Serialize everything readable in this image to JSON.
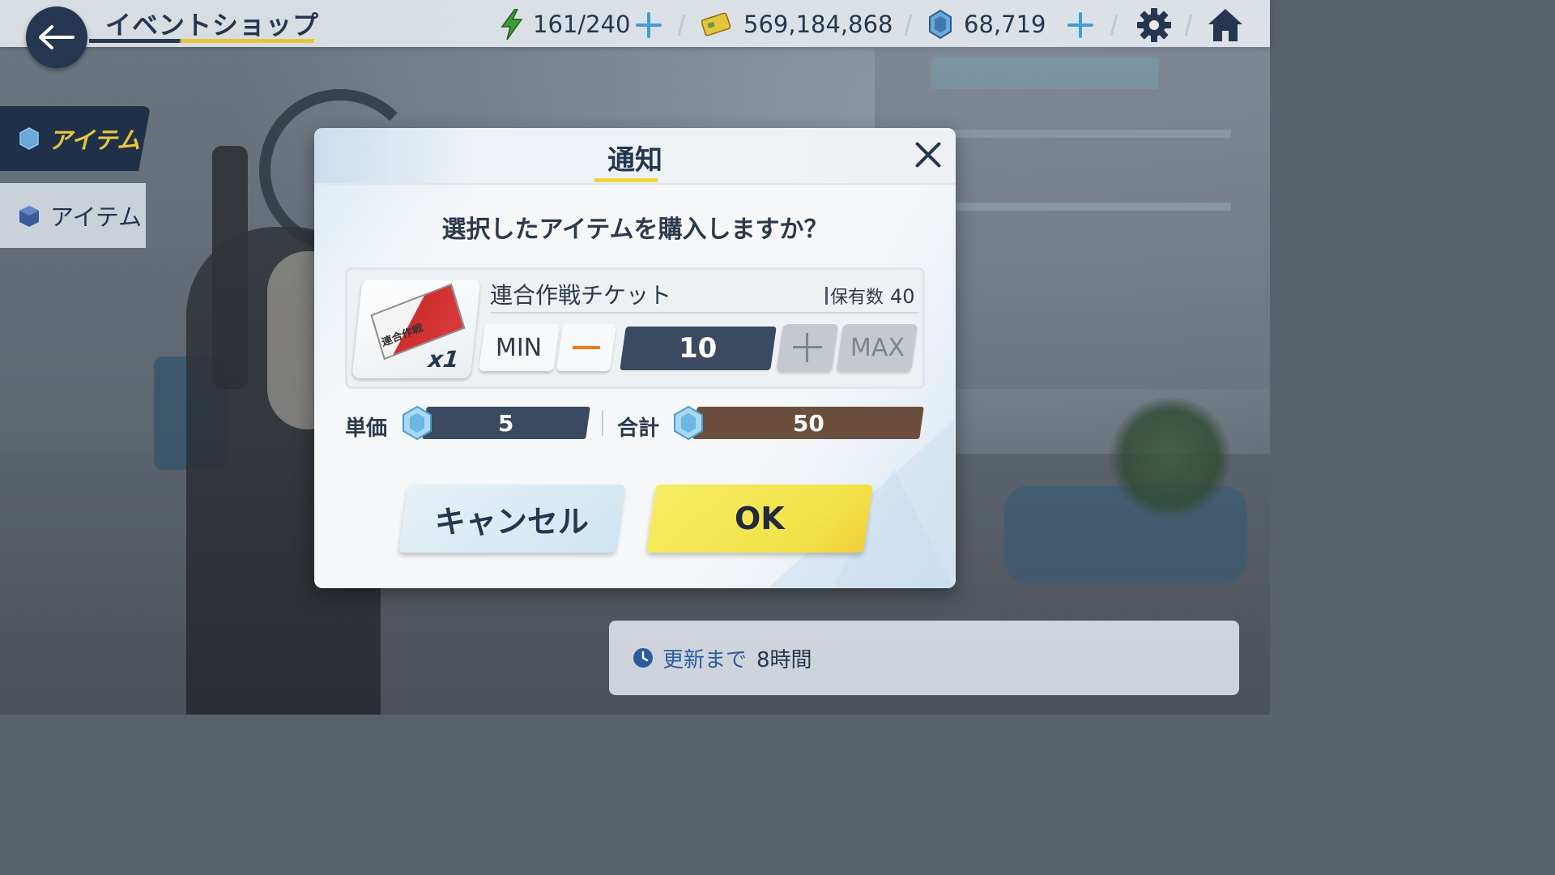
{
  "header": {
    "title": "イベントショップ",
    "stamina": "161/240",
    "credits": "569,184,868",
    "gems": "68,719"
  },
  "tabs": [
    {
      "label": "アイテム",
      "active": true
    },
    {
      "label": "アイテム",
      "active": false
    }
  ],
  "refresh": {
    "label": "更新まで",
    "time": "8時間"
  },
  "dialog": {
    "title": "通知",
    "question": "選択したアイテムを購入しますか？",
    "item": {
      "name": "連合作戦チケット",
      "owned_label": "保有数",
      "owned_count": "40",
      "quantity_badge": "x1",
      "thumb_text": "連合作戦"
    },
    "quantity": {
      "min_label": "MIN",
      "max_label": "MAX",
      "value": "10"
    },
    "price": {
      "unit_label": "単価",
      "unit_value": "5",
      "total_label": "合計",
      "total_value": "50"
    },
    "buttons": {
      "cancel": "キャンセル",
      "ok": "OK"
    }
  },
  "colors": {
    "navy": "#253650",
    "accent_yellow": "#f3e34a",
    "tab_active_text": "#e8c53e",
    "plus_blue": "#3f9fd3",
    "qty_display": "#3a4a60",
    "total_bar": "#6b4f3c",
    "minus_orange": "#f07a1c"
  },
  "icons": [
    "back-arrow-icon",
    "stamina-bolt-icon",
    "credit-card-icon",
    "gem-icon",
    "gear-icon",
    "home-icon",
    "close-icon",
    "clock-icon",
    "ticket-icon"
  ]
}
